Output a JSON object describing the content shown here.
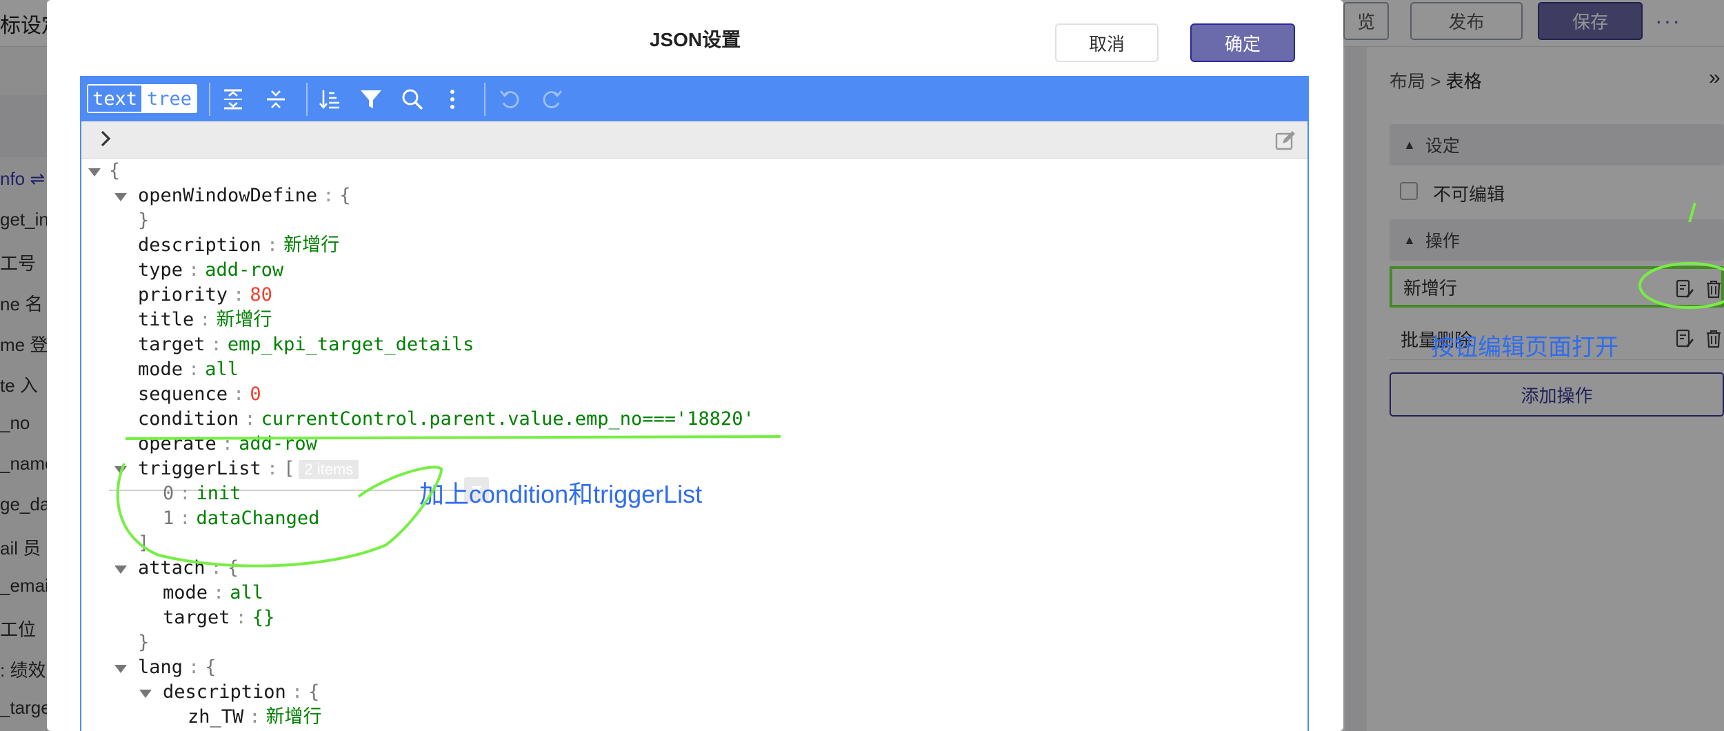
{
  "background": {
    "title_fragment": "标设定",
    "top_buttons": {
      "preview": "览",
      "publish": "发布",
      "save": "保存"
    },
    "left_fields": [
      {
        "text": "nfo ⇌",
        "blue": true
      },
      {
        "text": "get_in",
        "blue": false
      },
      {
        "text": "工号",
        "blue": false
      },
      {
        "text": "ne 名",
        "blue": false
      },
      {
        "text": "me 登",
        "blue": false
      },
      {
        "text": "te 入",
        "blue": false
      },
      {
        "text": "_no",
        "blue": false
      },
      {
        "text": "_name",
        "blue": false
      },
      {
        "text": "ge_da",
        "blue": false
      },
      {
        "text": "ail 员",
        "blue": false
      },
      {
        "text": "_emai",
        "blue": false
      },
      {
        "text": "工位",
        "blue": false
      },
      {
        "text": ": 绩效",
        "blue": false
      },
      {
        "text": "_targe",
        "blue": false
      }
    ],
    "right_panel": {
      "breadcrumb_parent": "布局",
      "breadcrumb_sep": ">",
      "breadcrumb_current": "表格",
      "section_settings": "设定",
      "checkbox_label": "不可编辑",
      "section_actions": "操作",
      "actions": [
        "新增行",
        "批量删除"
      ],
      "add_action_button": "添加操作",
      "annotation": "按钮编辑页面打开"
    }
  },
  "dialog": {
    "title": "JSON设置",
    "cancel": "取消",
    "ok": "确定",
    "mode_text": "text",
    "mode_tree": "tree",
    "annotation": "加上condition和triggerList",
    "tree": {
      "root_open": "{",
      "openWindowDefine": {
        "key": "openWindowDefine",
        "open": "{",
        "close": "}"
      },
      "fields": [
        {
          "key": "description",
          "value": "新增行",
          "kind": "s"
        },
        {
          "key": "type",
          "value": "add-row",
          "kind": "s"
        },
        {
          "key": "priority",
          "value": "80",
          "kind": "n"
        },
        {
          "key": "title",
          "value": "新增行",
          "kind": "s"
        },
        {
          "key": "target",
          "value": "emp_kpi_target_details",
          "kind": "s"
        },
        {
          "key": "mode",
          "value": "all",
          "kind": "s"
        },
        {
          "key": "sequence",
          "value": "0",
          "kind": "n"
        },
        {
          "key": "condition",
          "value": "currentControl.parent.value.emp_no==='18820'",
          "kind": "s"
        },
        {
          "key": "operate",
          "value": "add-row",
          "kind": "s"
        }
      ],
      "triggerList": {
        "key": "triggerList",
        "open": "[",
        "count": "2 items",
        "items": [
          {
            "idx": "0",
            "value": "init"
          },
          {
            "idx": "1",
            "value": "dataChanged"
          }
        ],
        "close": "]"
      },
      "attach": {
        "key": "attach",
        "open": "{",
        "mode_key": "mode",
        "mode_value": "all",
        "target_key": "target",
        "target_value": "{}",
        "close": "}"
      },
      "lang": {
        "key": "lang",
        "open": "{",
        "description_key": "description",
        "description_open": "{",
        "zh_key": "zh_TW",
        "zh_value": "新增行"
      },
      "colon": ":"
    }
  },
  "colors": {
    "accent": "#4f8bf4",
    "annotation_green": "#77ee44",
    "annotation_blue": "#2f6cf0",
    "primary_button": "#6b6aaa"
  }
}
